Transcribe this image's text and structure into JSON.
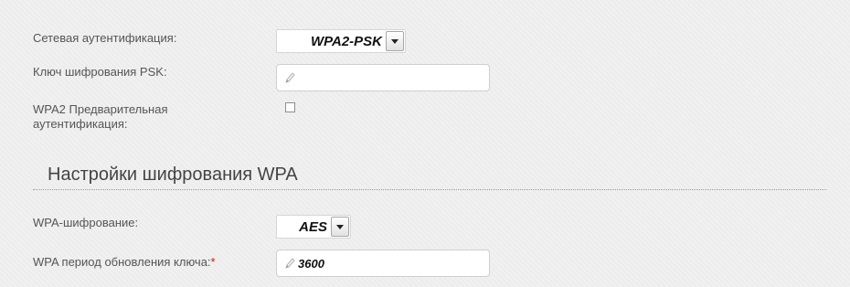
{
  "fields": {
    "auth_label": "Сетевая аутентификация:",
    "auth_value": "WPA2-PSK",
    "psk_label": "Ключ шифрования PSK:",
    "psk_value": "",
    "preauth_label_line1": "WPA2 Предварительная",
    "preauth_label_line2": "аутентификация:",
    "preauth_checked": false
  },
  "section": {
    "title": "Настройки шифрования WPA"
  },
  "wpa": {
    "cipher_label": "WPA-шифрование:",
    "cipher_value": "AES",
    "rekey_label": "WPA период обновления ключа:",
    "rekey_required_mark": "*",
    "rekey_value": "3600"
  },
  "icons": {
    "dropdown": "chevron-down-icon",
    "edit": "pencil-icon"
  },
  "colors": {
    "required": "#e01010",
    "background": "#ececec"
  }
}
